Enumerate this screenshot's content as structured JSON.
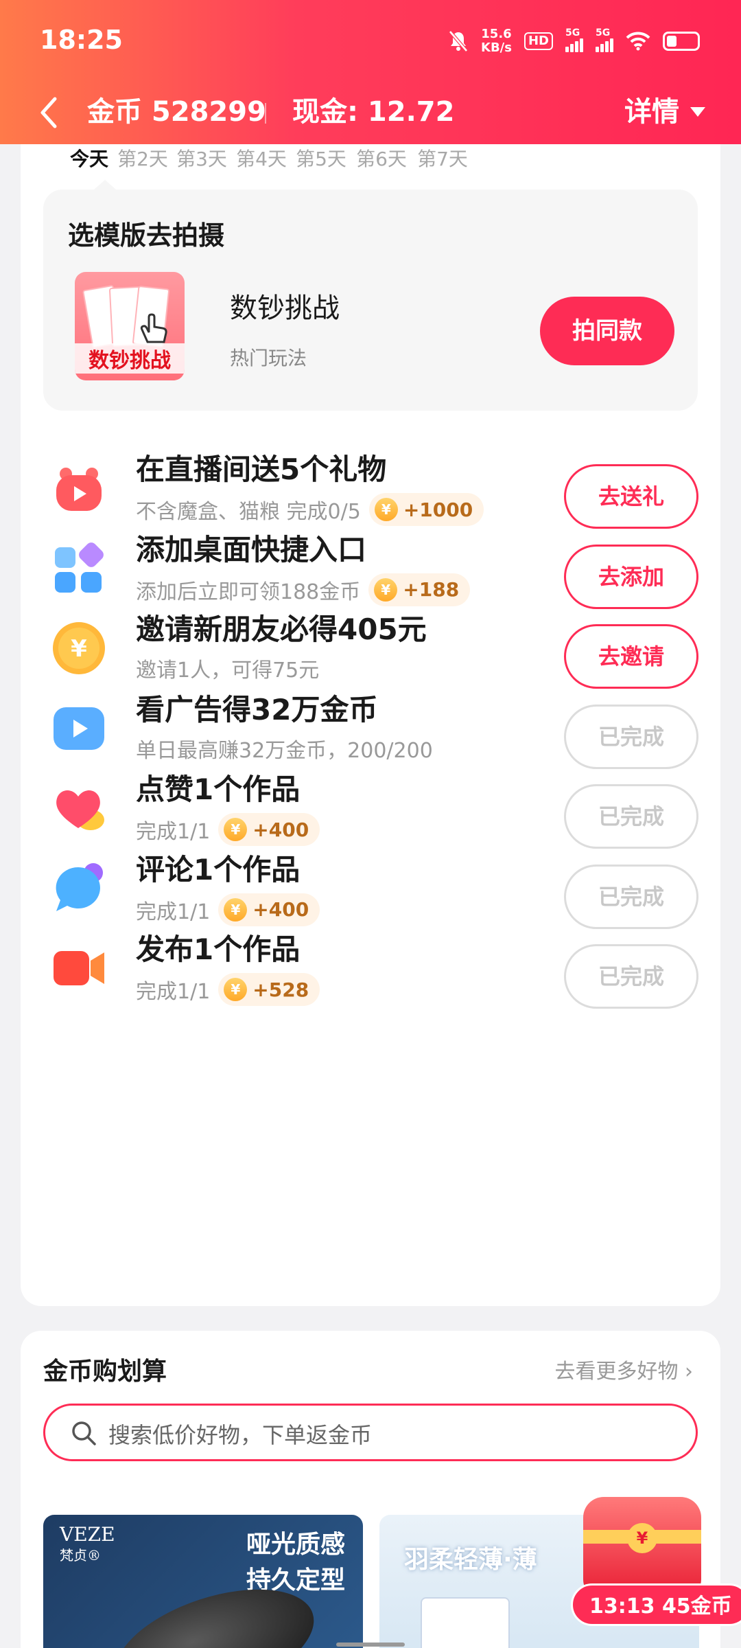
{
  "status_bar": {
    "time": "18:25",
    "net_speed_value": "15.6",
    "net_speed_unit": "KB/s",
    "hd": "HD",
    "sig1": "5G",
    "sig2": "5G",
    "battery_level": 0.3
  },
  "nav": {
    "coins": "金币 528299",
    "cash": "现金: 12.72",
    "detail": "详情"
  },
  "days": [
    "今天",
    "第2天",
    "第3天",
    "第4天",
    "第5天",
    "第6天",
    "第7天"
  ],
  "template": {
    "title": "选模版去拍摄",
    "thumb_text": "数钞挑战",
    "name": "数钞挑战",
    "sub": "热门玩法",
    "button": "拍同款"
  },
  "tasks": [
    {
      "title": "在直播间送5个礼物",
      "sub": "不含魔盒、猫粮 完成0/5",
      "reward": "+1000",
      "button": "去送礼",
      "done": false,
      "icon": "live-gift-icon"
    },
    {
      "title": "添加桌面快捷入口",
      "sub": "添加后立即可领188金币",
      "reward": "+188",
      "button": "去添加",
      "done": false,
      "icon": "shortcut-apps-icon"
    },
    {
      "title": "邀请新朋友必得405元",
      "sub": "邀请1人，可得75元",
      "reward": "",
      "button": "去邀请",
      "done": false,
      "icon": "yuan-coin-icon"
    },
    {
      "title": "看广告得32万金币",
      "sub": "单日最高赚32万金币，200/200",
      "reward": "",
      "button": "已完成",
      "done": true,
      "icon": "video-play-icon"
    },
    {
      "title": "点赞1个作品",
      "sub": "完成1/1",
      "reward": "+400",
      "button": "已完成",
      "done": true,
      "icon": "heart-icon"
    },
    {
      "title": "评论1个作品",
      "sub": "完成1/1",
      "reward": "+400",
      "button": "已完成",
      "done": true,
      "icon": "comment-bubble-icon"
    },
    {
      "title": "发布1个作品",
      "sub": "完成1/1",
      "reward": "+528",
      "button": "已完成",
      "done": true,
      "icon": "camera-icon"
    }
  ],
  "coin_symbol": "¥",
  "shop": {
    "title": "金币购划算",
    "more": "去看更多好物 ›",
    "search_placeholder": "搜索低价好物，下单返金币",
    "product1": {
      "brand": "VEZE",
      "brand_sub": "梵贞®",
      "slogan_line1": "哑光质感",
      "slogan_line2": "持久定型"
    },
    "product2": {
      "slogan": "羽柔轻薄·薄"
    }
  },
  "float_reward": {
    "label": "13:13 45金币",
    "seal": "¥"
  },
  "colors": {
    "accent": "#fe2c55",
    "header_start": "#ff7a4a",
    "header_end": "#ff2654"
  }
}
